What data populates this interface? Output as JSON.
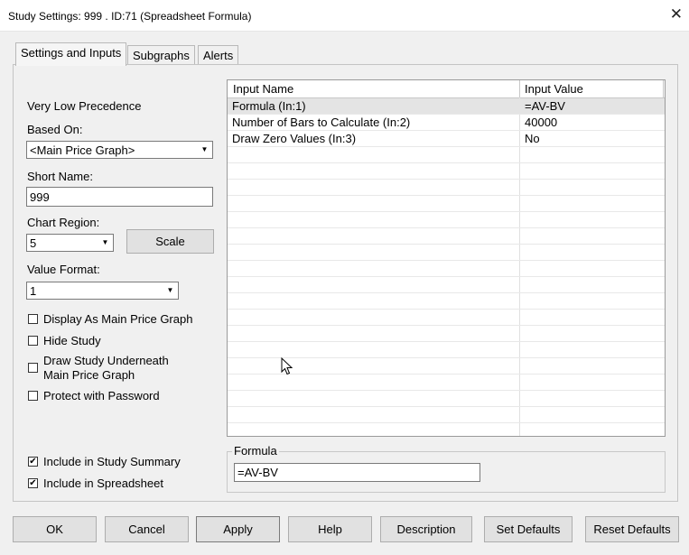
{
  "window": {
    "title": "Study Settings: 999 . ID:71 (Spreadsheet Formula)",
    "close_glyph": "✕"
  },
  "tabs": [
    {
      "label": "Settings and Inputs",
      "active": true
    },
    {
      "label": "Subgraphs",
      "active": false
    },
    {
      "label": "Alerts",
      "active": false
    }
  ],
  "left": {
    "precedence": "Very Low Precedence",
    "based_on_label": "Based On:",
    "based_on_value": "<Main Price Graph>",
    "short_name_label": "Short Name:",
    "short_name_value": "999",
    "chart_region_label": "Chart Region:",
    "chart_region_value": "5",
    "scale_button": "Scale",
    "value_format_label": "Value Format:",
    "value_format_value": "1",
    "checkboxes": [
      {
        "label": "Display As Main Price Graph",
        "checked": false
      },
      {
        "label": "Hide Study",
        "checked": false
      },
      {
        "label_line1": "Draw Study Underneath",
        "label_line2": "Main Price Graph",
        "checked": false
      },
      {
        "label": "Protect with Password",
        "checked": false
      }
    ],
    "include_summary": {
      "label": "Include in Study Summary",
      "checked": true
    },
    "include_spreadsheet": {
      "label": "Include in Spreadsheet",
      "checked": true
    }
  },
  "inputs_table": {
    "columns": [
      "Input Name",
      "Input Value"
    ],
    "rows": [
      {
        "name": "Formula  (In:1)",
        "value": "=AV-BV"
      },
      {
        "name": "Number of Bars to Calculate  (In:2)",
        "value": "40000"
      },
      {
        "name": "Draw Zero Values  (In:3)",
        "value": "No"
      }
    ]
  },
  "formula": {
    "label": "Formula",
    "value": "=AV-BV"
  },
  "buttons": {
    "ok": "OK",
    "cancel": "Cancel",
    "apply": "Apply",
    "help": "Help",
    "description": "Description",
    "set_defaults": "Set Defaults",
    "reset_defaults": "Reset Defaults"
  },
  "colors": {
    "background": "#f0f0f0",
    "selected_row": "#e4e4e4"
  }
}
